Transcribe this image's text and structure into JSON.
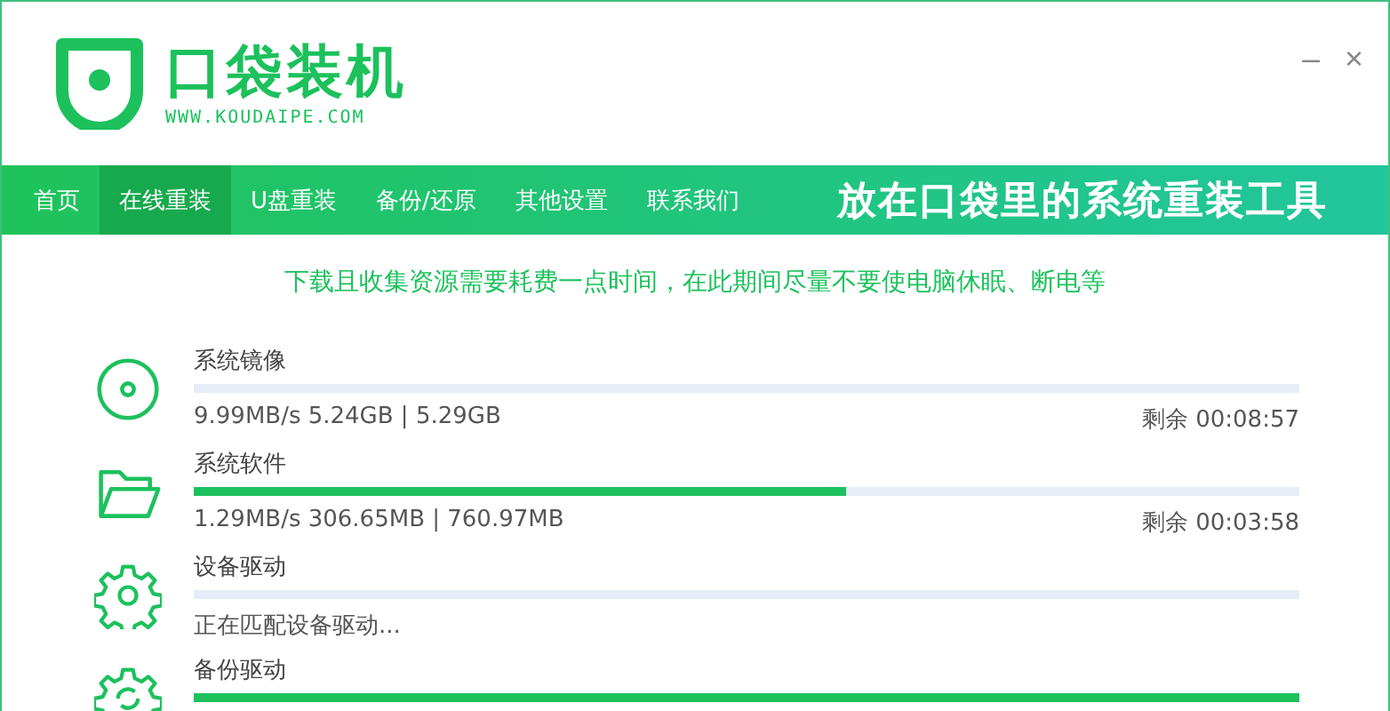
{
  "app": {
    "name": "口袋装机",
    "url": "WWW.KOUDAIPE.COM"
  },
  "window_controls": [
    "–",
    "×"
  ],
  "nav": {
    "items": [
      {
        "label": "首页",
        "selected": false
      },
      {
        "label": "在线重装",
        "selected": true
      },
      {
        "label": "U盘重装",
        "selected": false
      },
      {
        "label": "备份/还原",
        "selected": false
      },
      {
        "label": "其他设置",
        "selected": false
      },
      {
        "label": "联系我们",
        "selected": false
      }
    ],
    "slogan": "放在口袋里的系统重装工具"
  },
  "notice": "下载且收集资源需要耗费一点时间，在此期间尽量不要使电脑休眠、断电等",
  "tasks": [
    {
      "kind": "disc",
      "name": "系统镜像",
      "level": 0,
      "detail": "9.99MB/s 5.24GB | 5.29GB",
      "remaining": "剩余 00:08:57"
    },
    {
      "kind": "folder",
      "name": "系统软件",
      "level": 0.59,
      "detail": "1.29MB/s 306.65MB | 760.97MB",
      "remaining": "剩余 00:03:58"
    },
    {
      "kind": "gear",
      "name": "设备驱动",
      "level": 0,
      "detail": "正在匹配设备驱动..."
    },
    {
      "kind": "gear-sync",
      "name": "备份驱动",
      "level": 1
    }
  ]
}
